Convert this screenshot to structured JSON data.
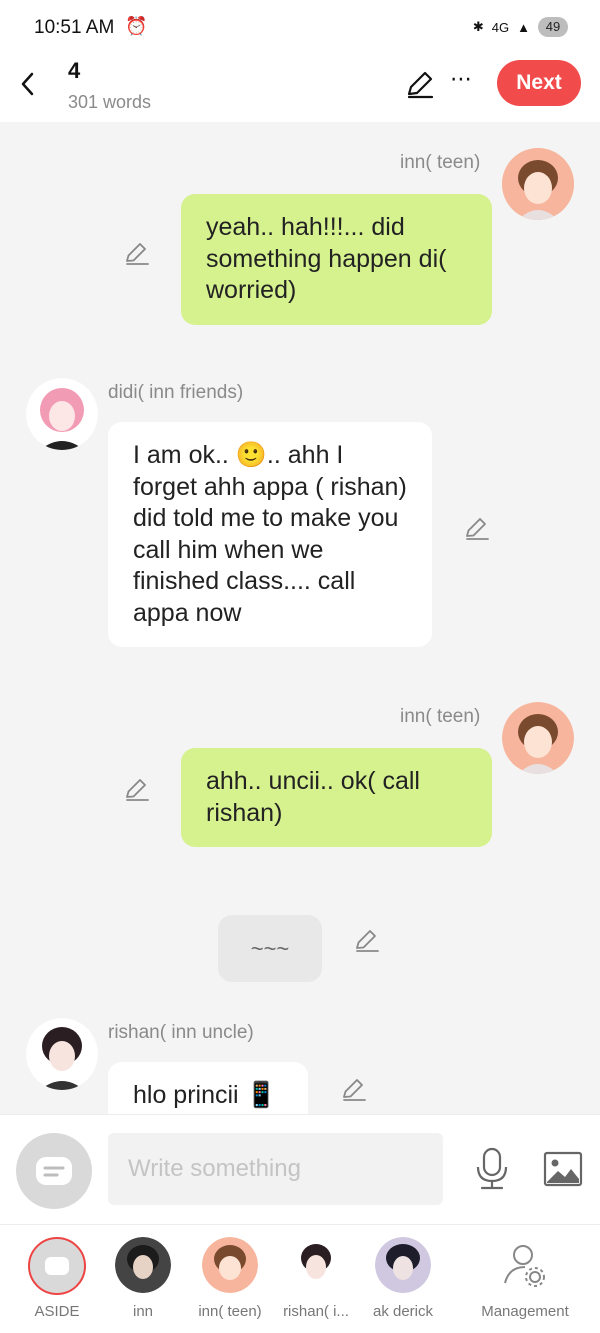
{
  "status_bar": {
    "time": "10:51 AM",
    "battery": "49",
    "network": "4G"
  },
  "header": {
    "title": "4",
    "word_count": "301 words",
    "next_label": "Next",
    "more_label": "⋯"
  },
  "messages": [
    {
      "speaker": "inn( teen)",
      "side": "right",
      "text": "yeah.. hah!!!... did something happen di( worried)"
    },
    {
      "speaker": "didi( inn friends)",
      "side": "left",
      "text": "I am ok.. 🙂.. ahh I forget ahh appa ( rishan) did told me to make you call him when we finished class.... call appa now"
    },
    {
      "speaker": "inn( teen)",
      "side": "right",
      "text": "ahh.. uncii.. ok( call rishan)"
    },
    {
      "speaker": "",
      "side": "narration",
      "text": "~~~"
    },
    {
      "speaker": "rishan( inn uncle)",
      "side": "left",
      "text": "hlo princii 📱"
    }
  ],
  "input": {
    "placeholder": "Write something"
  },
  "characters": [
    {
      "name": "ASIDE"
    },
    {
      "name": "inn"
    },
    {
      "name": "inn( teen)"
    },
    {
      "name": "rishan( i..."
    },
    {
      "name": "ak derick"
    },
    {
      "name": "Management"
    }
  ],
  "colors": {
    "accent": "#f24b4b",
    "right_bubble": "#d6f28f",
    "left_bubble": "#ffffff",
    "background": "#f4f4f4"
  }
}
